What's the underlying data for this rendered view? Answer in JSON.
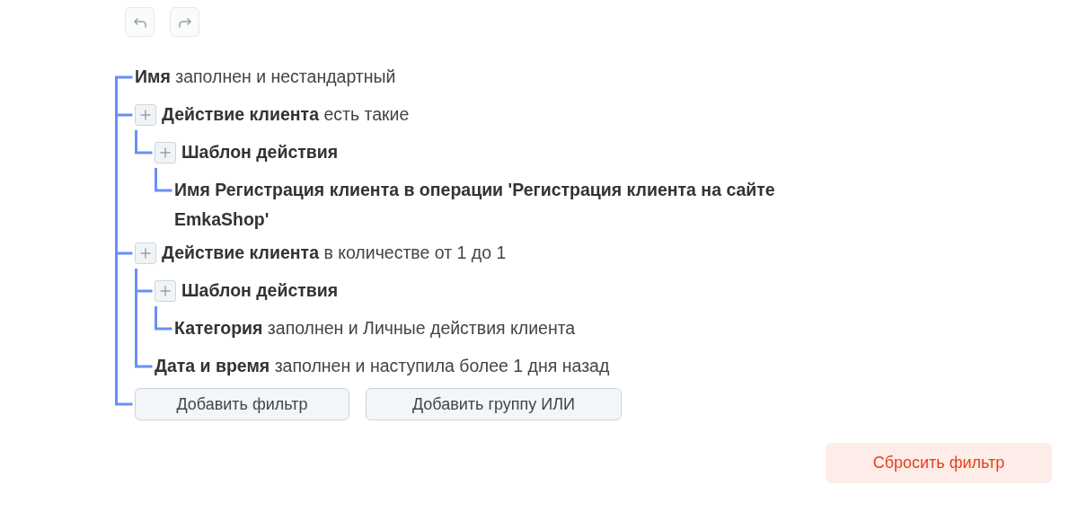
{
  "history": [
    {
      "kind": "undo"
    },
    {
      "kind": "redo"
    }
  ],
  "filter_tree": [
    {
      "field": "Имя",
      "condition": "заполнен и нестандартный",
      "expandable": false
    },
    {
      "field": "Действие клиента",
      "condition": "есть такие",
      "expandable": true,
      "children": [
        {
          "field": "Шаблон действия",
          "expandable": true,
          "children": [
            {
              "field": "Имя Регистрация клиента в операции 'Регистрация клиента на сайте EmkaShop'",
              "expandable": false
            }
          ]
        }
      ]
    },
    {
      "field": "Действие клиента",
      "condition": "в количестве от 1  до 1",
      "expandable": true,
      "children": [
        {
          "field": "Шаблон действия",
          "expandable": true,
          "children": [
            {
              "field": "Категория",
              "condition": "заполнен и Личные действия клиента",
              "expandable": false
            }
          ]
        },
        {
          "field": "Дата и время",
          "condition": "заполнен и наступила более 1 дня назад",
          "expandable": false
        }
      ]
    }
  ],
  "add_buttons": [
    "Добавить фильтр",
    "Добавить группу ИЛИ"
  ],
  "reset_button": "Сбросить фильтр"
}
